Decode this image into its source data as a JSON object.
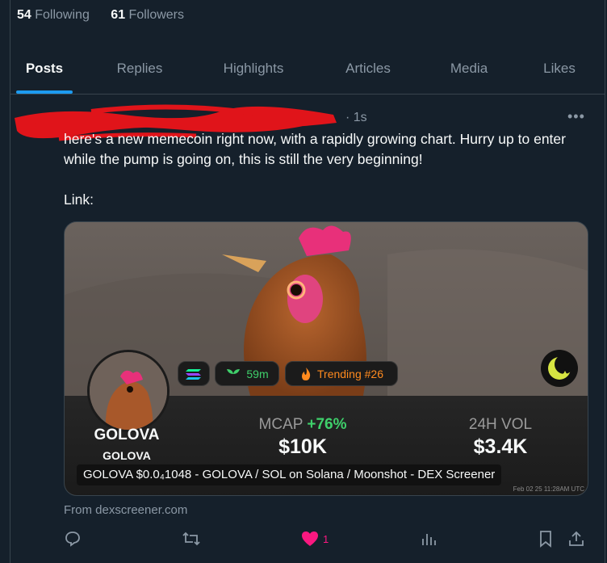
{
  "profile": {
    "following_count": "54",
    "following_label": "Following",
    "followers_count": "61",
    "followers_label": "Followers"
  },
  "tabs": [
    {
      "label": "Posts",
      "active": true
    },
    {
      "label": "Replies",
      "active": false
    },
    {
      "label": "Highlights",
      "active": false
    },
    {
      "label": "Articles",
      "active": false
    },
    {
      "label": "Media",
      "active": false
    },
    {
      "label": "Likes",
      "active": false
    }
  ],
  "post": {
    "timestamp": "· 1s",
    "more_icon": "more-horizontal-icon",
    "text_line1": "here's a new memecoin right now, with a rapidly growing chart. Hurry up to enter while the pump is going on, this is still the very beginning!",
    "text_line2": "Link:",
    "card": {
      "token_name": "GOLOVA",
      "token_symbol": "GOLOVA",
      "chain_badge_icon": "solana-icon",
      "age_label": "59m",
      "trending_label": "Trending #26",
      "mcap_label": "MCAP",
      "mcap_change": "+76%",
      "mcap_value": "$10K",
      "vol_label": "24H VOL",
      "vol_value": "$3.4K",
      "caption": "GOLOVA $0.0₄1048 - GOLOVA / SOL on Solana / Moonshot - DEX Screener",
      "image_stamp": "Feb 02 25 11:28AM UTC"
    },
    "source": "From dexscreener.com",
    "like_count": "1",
    "colors": {
      "accent": "#1d9bf0",
      "like": "#f91880",
      "green": "#3fd06b"
    }
  }
}
